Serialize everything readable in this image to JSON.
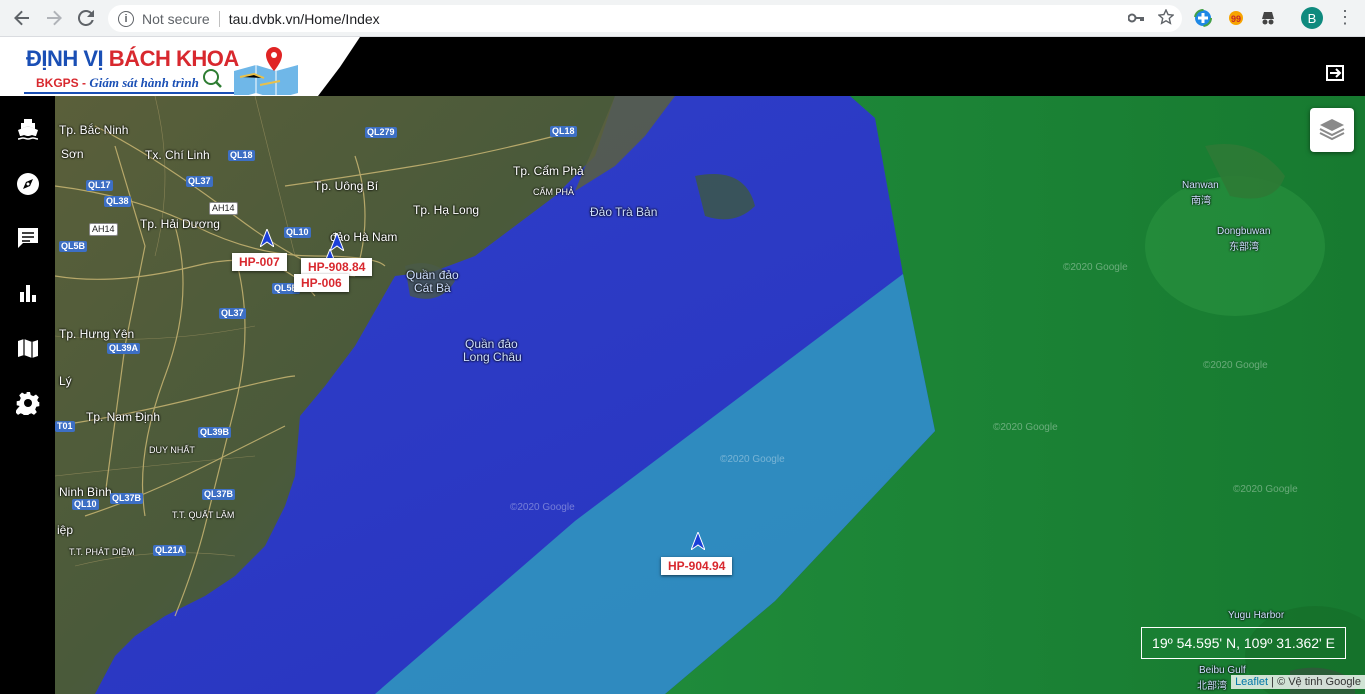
{
  "browser": {
    "security_label": "Not secure",
    "url": "tau.dvbk.vn/Home/Index",
    "profile_initial": "B"
  },
  "header": {
    "logo_part1": "ĐỊNH VỊ ",
    "logo_part2": "BÁCH KHOA",
    "logo_brand": "BKGPS",
    "logo_sep": " - ",
    "logo_desc": "Giám sát hành trình"
  },
  "sidebar": {
    "items": [
      {
        "icon": "ship-icon"
      },
      {
        "icon": "compass-icon"
      },
      {
        "icon": "message-icon"
      },
      {
        "icon": "chart-icon"
      },
      {
        "icon": "map-icon"
      },
      {
        "icon": "settings-icon"
      }
    ]
  },
  "map": {
    "places": {
      "bac_ninh": "Tp. Bắc Ninh",
      "son": "Sơn",
      "chi_linh": "Tx. Chí Linh",
      "uong_bi": "Tp. Uông Bí",
      "cam_pha": "Tp. Cẩm Phả",
      "cam_pha_small": "CẨM PHẢ",
      "ha_long": "Tp. Hạ Long",
      "dao_tra_ban": "Đảo Trà Bản",
      "hai_duong": "Tp. Hải Dương",
      "dao_ha_nam": "đảo Hà Nam",
      "cat_ba_1": "Quần đảo",
      "cat_ba_2": "Cát Bà",
      "long_chau_1": "Quần đảo",
      "long_chau_2": "Long Châu",
      "hung_yen": "Tp. Hưng Yên",
      "ly": "Lý",
      "nam_dinh": "Tp. Nam Định",
      "duy_nhat": "DUY NHẤT",
      "ninh_binh": "Ninh Bình",
      "quat_lam": "T.T. QUẤT LÂM",
      "phat_diem": "T.T. PHÁT DIỆM",
      "diep": "iệp",
      "nanwan": "Nanwan",
      "nanwan_cn": "南湾",
      "dongbuwan": "Dongbuwan",
      "dongbuwan_cn": "东部湾",
      "yugu": "Yugu Harbor",
      "beibu": "Beibu Gulf",
      "beibu_cn": "北部湾"
    },
    "roads": {
      "ql279": "QL279",
      "ql18a": "QL18",
      "ql18b": "QL18",
      "ql17": "QL17",
      "ql37a": "QL37",
      "ql38": "QL38",
      "ah14a": "AH14",
      "ah14b": "AH14",
      "ql5b": "QL5B",
      "ql10a": "QL10",
      "ql5ba": "QL5B",
      "ql37b": "QL37",
      "ql39a": "QL39A",
      "t01": "T01",
      "ql39b": "QL39B",
      "ql37bb": "QL37B",
      "ql37bc": "QL37B",
      "ql10b": "QL10",
      "ql21a": "QL21A"
    },
    "vehicles": [
      {
        "label": "HP-007"
      },
      {
        "label": "HP-908.84"
      },
      {
        "label": "HP-006"
      },
      {
        "label": "HP-904.94"
      }
    ],
    "coordinates": "19º 54.595' N, 109º 31.362' E",
    "attribution_link": "Leaflet",
    "attribution_text": " | © Vệ tinh Google",
    "watermarks": [
      "©2020 Google",
      "©2020 Google",
      "©2020 Google",
      "©2020 Google",
      "©2020 Google",
      "©2020 Google"
    ]
  },
  "colors": {
    "brand_blue": "#1a4fb5",
    "brand_red": "#d8282e",
    "sea_dark": "#2d3fc0",
    "sea_light": "#2a8fb0",
    "land_green": "#1f8a3a"
  }
}
